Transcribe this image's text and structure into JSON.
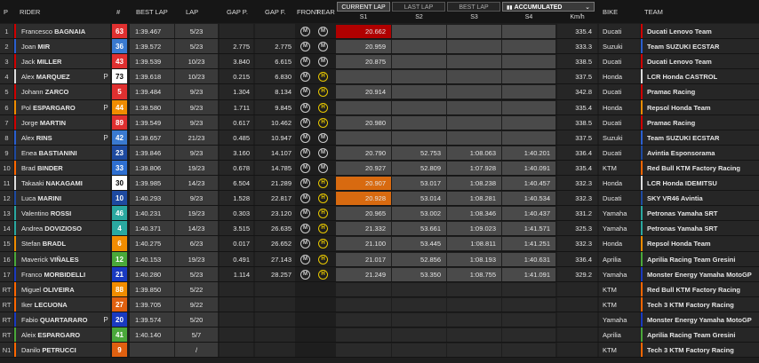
{
  "headers": {
    "pos": "P",
    "rider": "RIDER",
    "num": "#",
    "best_lap": "BEST LAP",
    "lap": "LAP",
    "gap_p": "GAP P.",
    "gap_f": "GAP F.",
    "front": "FRONT",
    "rear": "REAR",
    "kmh": "Km/h",
    "bike": "BIKE",
    "team": "TEAM",
    "s1": "S1",
    "s2": "S2",
    "s3": "S3",
    "s4": "S4"
  },
  "tabs": {
    "current_lap": "CURRENT LAP",
    "last_lap": "LAST LAP",
    "best_lap": "BEST LAP",
    "accumulated": "ACCUMULATED"
  },
  "rows": [
    {
      "pos": "1",
      "first": "Francesco",
      "last": "BAGNAIA",
      "p": "",
      "num": "63",
      "num_bg": "#e03030",
      "num_fg": "#ffffff",
      "best": "1:39.467",
      "lap": "5/23",
      "gap_p": "",
      "gap_f": "",
      "front": "M",
      "rear": "M",
      "s1": "20.662",
      "s1_bg": "#b00000",
      "s2": "",
      "s3": "",
      "s4": "",
      "kmh": "335.4",
      "bike": "Ducati",
      "team": "Ducati Lenovo Team",
      "team_color": "#d00000"
    },
    {
      "pos": "2",
      "first": "Joan",
      "last": "MIR",
      "p": "",
      "num": "36",
      "num_bg": "#3a7ad0",
      "num_fg": "#ffffff",
      "best": "1:39.572",
      "lap": "5/23",
      "gap_p": "2.775",
      "gap_f": "2.775",
      "front": "M",
      "rear": "M",
      "s1": "20.959",
      "s1_bg": "",
      "s2": "",
      "s3": "",
      "s4": "",
      "kmh": "333.3",
      "bike": "Suzuki",
      "team": "Team SUZUKI ECSTAR",
      "team_color": "#2a5fd0"
    },
    {
      "pos": "3",
      "first": "Jack",
      "last": "MILLER",
      "p": "",
      "num": "43",
      "num_bg": "#e03030",
      "num_fg": "#ffffff",
      "best": "1:39.539",
      "lap": "10/23",
      "gap_p": "3.840",
      "gap_f": "6.615",
      "front": "M",
      "rear": "M",
      "s1": "20.875",
      "s1_bg": "",
      "s2": "",
      "s3": "",
      "s4": "",
      "kmh": "338.5",
      "bike": "Ducati",
      "team": "Ducati Lenovo Team",
      "team_color": "#d00000"
    },
    {
      "pos": "4",
      "first": "Alex",
      "last": "MARQUEZ",
      "p": "P",
      "num": "73",
      "num_bg": "#ffffff",
      "num_fg": "#000000",
      "best": "1:39.618",
      "lap": "10/23",
      "gap_p": "0.215",
      "gap_f": "6.830",
      "front": "M",
      "rear": "H",
      "s1": "",
      "s1_bg": "",
      "s2": "",
      "s3": "",
      "s4": "",
      "kmh": "337.5",
      "bike": "Honda",
      "team": "LCR Honda CASTROL",
      "team_color": "#dddddd"
    },
    {
      "pos": "5",
      "first": "Johann",
      "last": "ZARCO",
      "p": "",
      "num": "5",
      "num_bg": "#e03030",
      "num_fg": "#ffffff",
      "best": "1:39.484",
      "lap": "9/23",
      "gap_p": "1.304",
      "gap_f": "8.134",
      "front": "M",
      "rear": "H",
      "s1": "20.914",
      "s1_bg": "",
      "s2": "",
      "s3": "",
      "s4": "",
      "kmh": "342.8",
      "bike": "Ducati",
      "team": "Pramac Racing",
      "team_color": "#d00000"
    },
    {
      "pos": "6",
      "first": "Pol",
      "last": "ESPARGARO",
      "p": "P",
      "num": "44",
      "num_bg": "#f08c00",
      "num_fg": "#ffffff",
      "best": "1:39.580",
      "lap": "9/23",
      "gap_p": "1.711",
      "gap_f": "9.845",
      "front": "M",
      "rear": "H",
      "s1": "",
      "s1_bg": "",
      "s2": "",
      "s3": "",
      "s4": "",
      "kmh": "335.4",
      "bike": "Honda",
      "team": "Repsol Honda Team",
      "team_color": "#f08c00"
    },
    {
      "pos": "7",
      "first": "Jorge",
      "last": "MARTIN",
      "p": "",
      "num": "89",
      "num_bg": "#e03030",
      "num_fg": "#ffffff",
      "best": "1:39.549",
      "lap": "9/23",
      "gap_p": "0.617",
      "gap_f": "10.462",
      "front": "M",
      "rear": "H",
      "s1": "20.980",
      "s1_bg": "",
      "s2": "",
      "s3": "",
      "s4": "",
      "kmh": "338.5",
      "bike": "Ducati",
      "team": "Pramac Racing",
      "team_color": "#d00000"
    },
    {
      "pos": "8",
      "first": "Alex",
      "last": "RINS",
      "p": "P",
      "num": "42",
      "num_bg": "#3a7ad0",
      "num_fg": "#ffffff",
      "best": "1:39.657",
      "lap": "21/23",
      "gap_p": "0.485",
      "gap_f": "10.947",
      "front": "M",
      "rear": "M",
      "s1": "",
      "s1_bg": "",
      "s2": "",
      "s3": "",
      "s4": "",
      "kmh": "337.5",
      "bike": "Suzuki",
      "team": "Team SUZUKI ECSTAR",
      "team_color": "#2a5fd0"
    },
    {
      "pos": "9",
      "first": "Enea",
      "last": "BASTIANINI",
      "p": "",
      "num": "23",
      "num_bg": "#1e4aa0",
      "num_fg": "#ffffff",
      "best": "1:39.846",
      "lap": "9/23",
      "gap_p": "3.160",
      "gap_f": "14.107",
      "front": "M",
      "rear": "M",
      "s1": "20.790",
      "s1_bg": "",
      "s2": "52.753",
      "s3": "1:08.063",
      "s4": "1:40.201",
      "kmh": "336.4",
      "bike": "Ducati",
      "team": "Avintia Esponsorama",
      "team_color": "#1e4aa0"
    },
    {
      "pos": "10",
      "first": "Brad",
      "last": "BINDER",
      "p": "",
      "num": "33",
      "num_bg": "#2e6fd0",
      "num_fg": "#ffffff",
      "best": "1:39.806",
      "lap": "19/23",
      "gap_p": "0.678",
      "gap_f": "14.785",
      "front": "M",
      "rear": "M",
      "s1": "20.927",
      "s1_bg": "",
      "s2": "52.809",
      "s3": "1:07.928",
      "s4": "1:40.091",
      "kmh": "335.4",
      "bike": "KTM",
      "team": "Red Bull KTM Factory Racing",
      "team_color": "#ff6600"
    },
    {
      "pos": "11",
      "first": "Takaaki",
      "last": "NAKAGAMI",
      "p": "",
      "num": "30",
      "num_bg": "#ffffff",
      "num_fg": "#000000",
      "best": "1:39.985",
      "lap": "14/23",
      "gap_p": "6.504",
      "gap_f": "21.289",
      "front": "M",
      "rear": "H",
      "s1": "20.907",
      "s1_bg": "#d86a10",
      "s2": "53.017",
      "s3": "1:08.238",
      "s4": "1:40.457",
      "kmh": "332.3",
      "bike": "Honda",
      "team": "LCR Honda IDEMITSU",
      "team_color": "#dddddd"
    },
    {
      "pos": "12",
      "first": "Luca",
      "last": "MARINI",
      "p": "",
      "num": "10",
      "num_bg": "#1e4aa0",
      "num_fg": "#ffffff",
      "best": "1:40.293",
      "lap": "9/23",
      "gap_p": "1.528",
      "gap_f": "22.817",
      "front": "M",
      "rear": "H",
      "s1": "20.928",
      "s1_bg": "#d86a10",
      "s2": "53.014",
      "s3": "1:08.281",
      "s4": "1:40.534",
      "kmh": "332.3",
      "bike": "Ducati",
      "team": "SKY VR46 Avintia",
      "team_color": "#1e4aa0"
    },
    {
      "pos": "13",
      "first": "Valentino",
      "last": "ROSSI",
      "p": "",
      "num": "46",
      "num_bg": "#2aa8a0",
      "num_fg": "#ffffff",
      "best": "1:40.231",
      "lap": "19/23",
      "gap_p": "0.303",
      "gap_f": "23.120",
      "front": "M",
      "rear": "H",
      "s1": "20.965",
      "s1_bg": "",
      "s2": "53.002",
      "s3": "1:08.346",
      "s4": "1:40.437",
      "kmh": "331.2",
      "bike": "Yamaha",
      "team": "Petronas Yamaha SRT",
      "team_color": "#2aa8a0"
    },
    {
      "pos": "14",
      "first": "Andrea",
      "last": "DOVIZIOSO",
      "p": "",
      "num": "4",
      "num_bg": "#2aa8a0",
      "num_fg": "#ffffff",
      "best": "1:40.371",
      "lap": "14/23",
      "gap_p": "3.515",
      "gap_f": "26.635",
      "front": "M",
      "rear": "H",
      "s1": "21.332",
      "s1_bg": "",
      "s2": "53.661",
      "s3": "1:09.023",
      "s4": "1:41.571",
      "kmh": "325.3",
      "bike": "Yamaha",
      "team": "Petronas Yamaha SRT",
      "team_color": "#2aa8a0"
    },
    {
      "pos": "15",
      "first": "Stefan",
      "last": "BRADL",
      "p": "",
      "num": "6",
      "num_bg": "#f08c00",
      "num_fg": "#ffffff",
      "best": "1:40.275",
      "lap": "6/23",
      "gap_p": "0.017",
      "gap_f": "26.652",
      "front": "M",
      "rear": "H",
      "s1": "21.100",
      "s1_bg": "",
      "s2": "53.445",
      "s3": "1:08.811",
      "s4": "1:41.251",
      "kmh": "332.3",
      "bike": "Honda",
      "team": "Repsol Honda Team",
      "team_color": "#f08c00"
    },
    {
      "pos": "16",
      "first": "Maverick",
      "last": "VIÑALES",
      "p": "",
      "num": "12",
      "num_bg": "#4aa83a",
      "num_fg": "#ffffff",
      "best": "1:40.153",
      "lap": "19/23",
      "gap_p": "0.491",
      "gap_f": "27.143",
      "front": "M",
      "rear": "H",
      "s1": "21.017",
      "s1_bg": "",
      "s2": "52.856",
      "s3": "1:08.193",
      "s4": "1:40.631",
      "kmh": "336.4",
      "bike": "Aprilia",
      "team": "Aprilia Racing Team Gresini",
      "team_color": "#4aa83a"
    },
    {
      "pos": "17",
      "first": "Franco",
      "last": "MORBIDELLI",
      "p": "",
      "num": "21",
      "num_bg": "#1a3ac0",
      "num_fg": "#ffffff",
      "best": "1:40.280",
      "lap": "5/23",
      "gap_p": "1.114",
      "gap_f": "28.257",
      "front": "M",
      "rear": "H",
      "s1": "21.249",
      "s1_bg": "",
      "s2": "53.350",
      "s3": "1:08.755",
      "s4": "1:41.091",
      "kmh": "329.2",
      "bike": "Yamaha",
      "team": "Monster Energy Yamaha MotoGP",
      "team_color": "#1a3ac0"
    },
    {
      "pos": "RT",
      "first": "Miguel",
      "last": "OLIVEIRA",
      "p": "",
      "num": "88",
      "num_bg": "#f08c00",
      "num_fg": "#ffffff",
      "best": "1:39.850",
      "lap": "5/22",
      "gap_p": "",
      "gap_f": "",
      "front": "",
      "rear": "",
      "s1": "",
      "s1_bg": "",
      "s2": "",
      "s3": "",
      "s4": "",
      "kmh": "",
      "bike": "KTM",
      "team": "Red Bull KTM Factory Racing",
      "team_color": "#ff6600"
    },
    {
      "pos": "RT",
      "first": "Iker",
      "last": "LECUONA",
      "p": "",
      "num": "27",
      "num_bg": "#e06010",
      "num_fg": "#ffffff",
      "best": "1:39.705",
      "lap": "9/22",
      "gap_p": "",
      "gap_f": "",
      "front": "",
      "rear": "",
      "s1": "",
      "s1_bg": "",
      "s2": "",
      "s3": "",
      "s4": "",
      "kmh": "",
      "bike": "KTM",
      "team": "Tech 3 KTM Factory Racing",
      "team_color": "#ff6600"
    },
    {
      "pos": "RT",
      "first": "Fabio",
      "last": "QUARTARARO",
      "p": "P",
      "num": "20",
      "num_bg": "#1a3ac0",
      "num_fg": "#ffffff",
      "best": "1:39.574",
      "lap": "5/20",
      "gap_p": "",
      "gap_f": "",
      "front": "",
      "rear": "",
      "s1": "",
      "s1_bg": "",
      "s2": "",
      "s3": "",
      "s4": "",
      "kmh": "",
      "bike": "Yamaha",
      "team": "Monster Energy Yamaha MotoGP",
      "team_color": "#1a3ac0"
    },
    {
      "pos": "RT",
      "first": "Aleix",
      "last": "ESPARGARO",
      "p": "",
      "num": "41",
      "num_bg": "#4aa83a",
      "num_fg": "#ffffff",
      "best": "1:40.140",
      "lap": "5/7",
      "gap_p": "",
      "gap_f": "",
      "front": "",
      "rear": "",
      "s1": "",
      "s1_bg": "",
      "s2": "",
      "s3": "",
      "s4": "",
      "kmh": "",
      "bike": "Aprilia",
      "team": "Aprilia Racing Team Gresini",
      "team_color": "#4aa83a"
    },
    {
      "pos": "N1",
      "first": "Danilo",
      "last": "PETRUCCI",
      "p": "",
      "num": "9",
      "num_bg": "#e06010",
      "num_fg": "#ffffff",
      "best": "",
      "lap": "/",
      "gap_p": "",
      "gap_f": "",
      "front": "",
      "rear": "",
      "s1": "",
      "s1_bg": "",
      "s2": "",
      "s3": "",
      "s4": "",
      "kmh": "",
      "bike": "KTM",
      "team": "Tech 3 KTM Factory Racing",
      "team_color": "#ff6600"
    }
  ]
}
